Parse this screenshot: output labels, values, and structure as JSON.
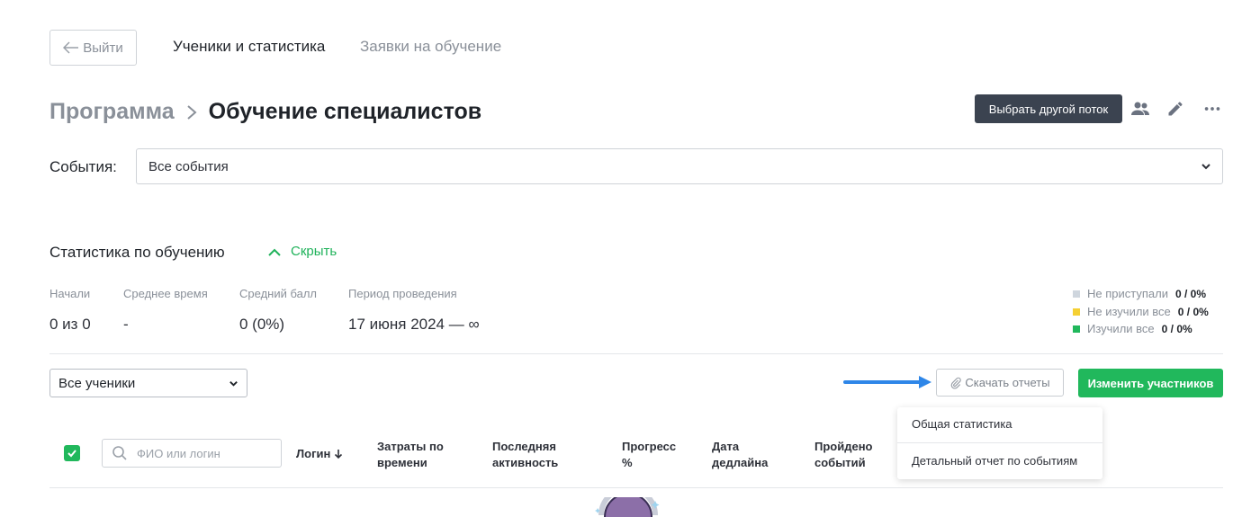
{
  "nav": {
    "back_label": "Выйти",
    "tabs": [
      {
        "label": "Ученики и статистика",
        "active": true
      },
      {
        "label": "Заявки на обучение",
        "active": false
      }
    ]
  },
  "header": {
    "breadcrumb_parent": "Программа",
    "breadcrumb_current": "Обучение специалистов",
    "choose_stream_label": "Выбрать другой поток"
  },
  "events": {
    "label": "События:",
    "selected": "Все события"
  },
  "stats": {
    "title": "Статистика по обучению",
    "hide_label": "Скрыть",
    "items": [
      {
        "label": "Начали",
        "value": "0 из 0"
      },
      {
        "label": "Среднее время",
        "value": "-"
      },
      {
        "label": "Средний балл",
        "value": "0 (0%)"
      },
      {
        "label": "Период проведения",
        "value": "17 июня 2024 — ∞"
      }
    ],
    "legend": [
      {
        "label": "Не приступали",
        "value": "0 / 0%",
        "color": "#cfd6de"
      },
      {
        "label": "Не изучили все",
        "value": "0 / 0%",
        "color": "#f5d033"
      },
      {
        "label": "Изучили все",
        "value": "0 / 0%",
        "color": "#21b85c"
      }
    ]
  },
  "students": {
    "filter_selected": "Все ученики",
    "download_label": "Скачать отчеты",
    "change_label": "Изменить участников",
    "menu": [
      "Общая статистика",
      "Детальный отчет по событиям"
    ]
  },
  "table": {
    "search_placeholder": "ФИО или логин",
    "columns": [
      "Логин",
      "Затраты по\nвремени",
      "Последняя\nактивность",
      "Прогресс\n%",
      "Дата\nдедлайна",
      "Пройдено\nсобытий"
    ]
  },
  "colors": {
    "accent_green": "#21b85c",
    "dark_button": "#3b4350",
    "arrow_blue": "#2e86e8"
  }
}
